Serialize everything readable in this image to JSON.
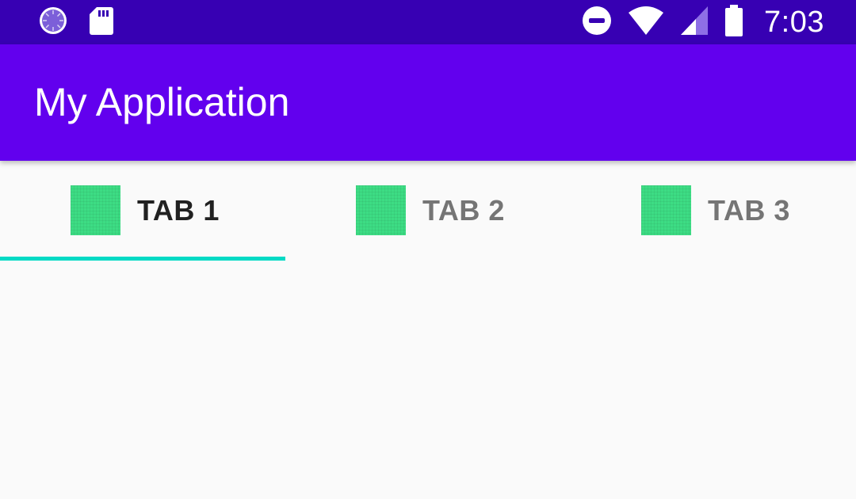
{
  "status_bar": {
    "time": "7:03",
    "left_icons": [
      "sync-icon",
      "sd-card-icon"
    ],
    "right_icons": [
      "do-not-disturb-icon",
      "wifi-icon",
      "signal-icon",
      "battery-icon"
    ]
  },
  "app_bar": {
    "title": "My Application"
  },
  "tabs": [
    {
      "label": "TAB 1",
      "icon": "tab-image-icon",
      "selected": true
    },
    {
      "label": "TAB 2",
      "icon": "tab-image-icon",
      "selected": false
    },
    {
      "label": "TAB 3",
      "icon": "tab-image-icon",
      "selected": false
    }
  ],
  "colors": {
    "status_bar": "#3700b3",
    "primary": "#6200ee",
    "indicator": "#03dac5",
    "tab_icon": "#3ddc84",
    "background": "#fafafa"
  }
}
